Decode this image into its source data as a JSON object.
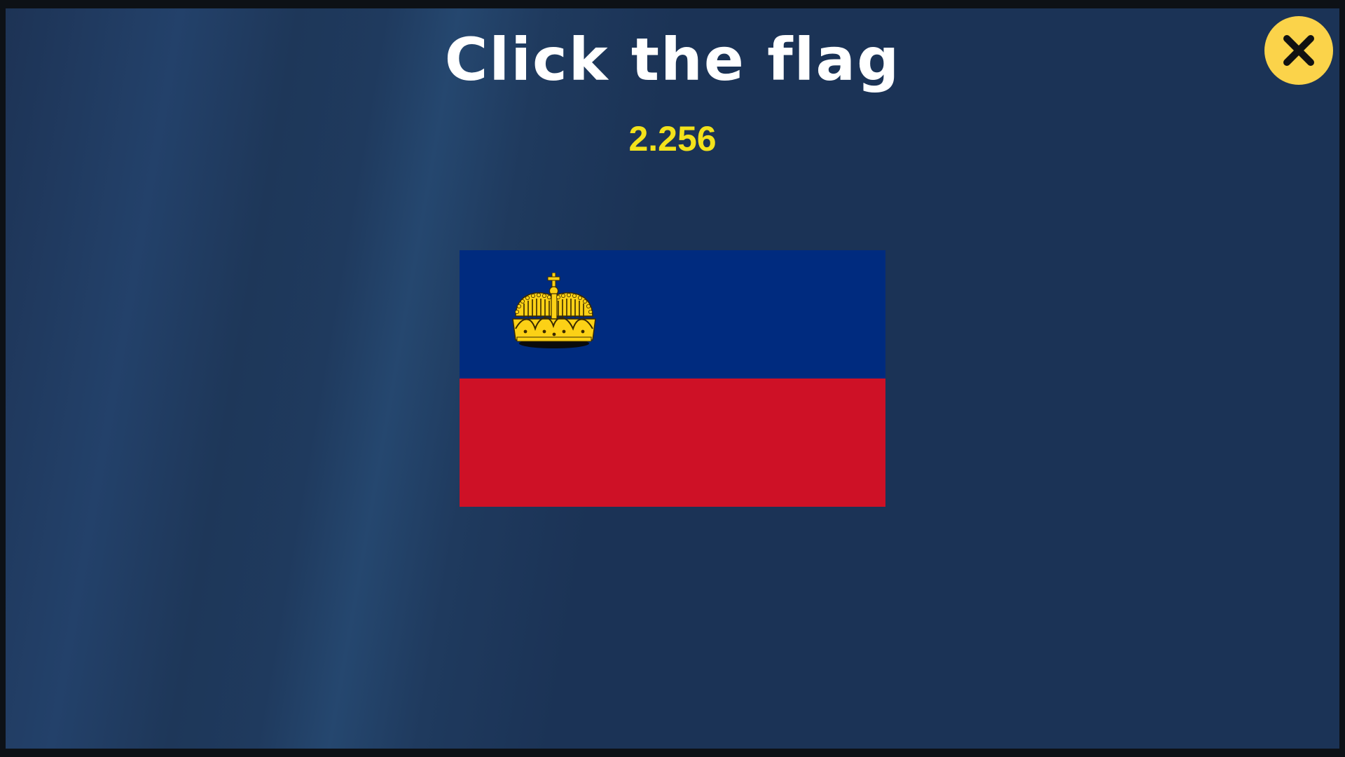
{
  "game": {
    "title": "Click the flag",
    "timer": "2.256"
  },
  "close_button": {
    "icon": "close-icon"
  },
  "flag": {
    "country": "Liechtenstein",
    "emblem_icon": "crown-icon",
    "colors": {
      "top": "#002b7f",
      "bottom": "#ce1126",
      "crown": "#fcd116"
    }
  },
  "colors": {
    "background": "#1b3356",
    "title": "#ffffff",
    "timer": "#f3e21b",
    "close_button": "#fbd34a"
  }
}
